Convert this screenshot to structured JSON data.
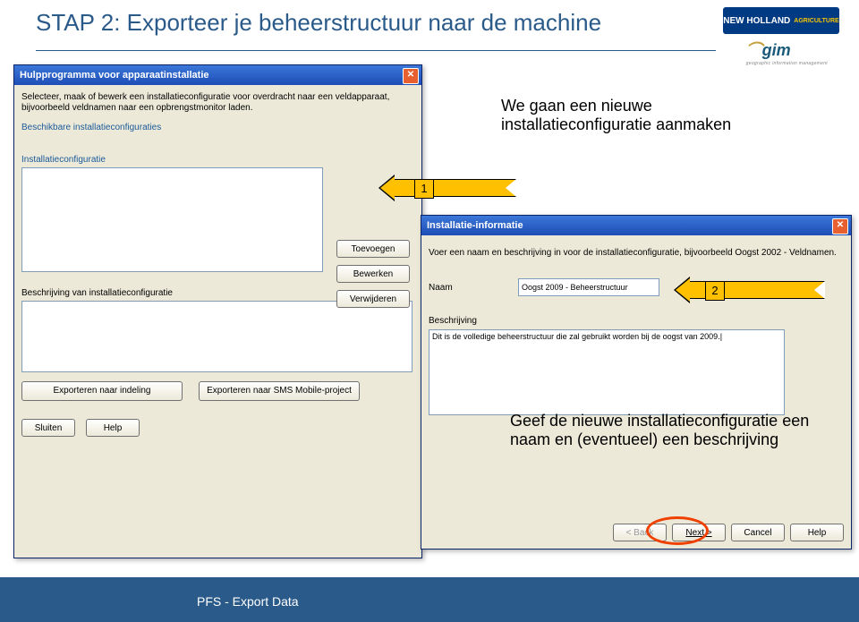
{
  "slide": {
    "title": "STAP 2: Exporteer je beheerstructuur naar de machine",
    "footer": "PFS  -  Export Data"
  },
  "logos": {
    "nh_text": "NEW HOLLAND",
    "nh_sub": "AGRICULTURE",
    "gim": "gim",
    "gim_sub": "geographic information management"
  },
  "callouts": {
    "c1_text": "We gaan een nieuwe installatieconfiguratie aanmaken",
    "c1_num": "1",
    "c2_text": "Geef de nieuwe installatieconfiguratie een naam en (eventueel) een beschrijving",
    "c2_num": "2"
  },
  "dlg1": {
    "title": "Hulpprogramma voor apparaatinstallatie",
    "intro": "Selecteer, maak of bewerk een installatieconfiguratie voor overdracht naar een veldapparaat, bijvoorbeeld veldnamen naar een opbrengstmonitor laden.",
    "sec1": "Beschikbare installatieconfiguraties",
    "sec2": "Installatieconfiguratie",
    "btn_add": "Toevoegen",
    "btn_edit": "Bewerken",
    "btn_del": "Verwijderen",
    "sec3": "Beschrijving van installatieconfiguratie",
    "btn_export1": "Exporteren naar indeling",
    "btn_export2": "Exporteren naar SMS Mobile-project",
    "btn_close": "Sluiten",
    "btn_help": "Help"
  },
  "dlg2": {
    "title": "Installatie-informatie",
    "intro": "Voer een naam en beschrijving in voor de installatieconfiguratie, bijvoorbeeld Oogst 2002 - Veldnamen.",
    "name_label": "Naam",
    "name_value": "Oogst 2009 - Beheerstructuur",
    "desc_label": "Beschrijving",
    "desc_value": "Dit is de volledige beheerstructuur die zal gebruikt worden bij de oogst van 2009.|",
    "btn_back": "< Back",
    "btn_next": "Next >",
    "btn_cancel": "Cancel",
    "btn_help": "Help"
  }
}
